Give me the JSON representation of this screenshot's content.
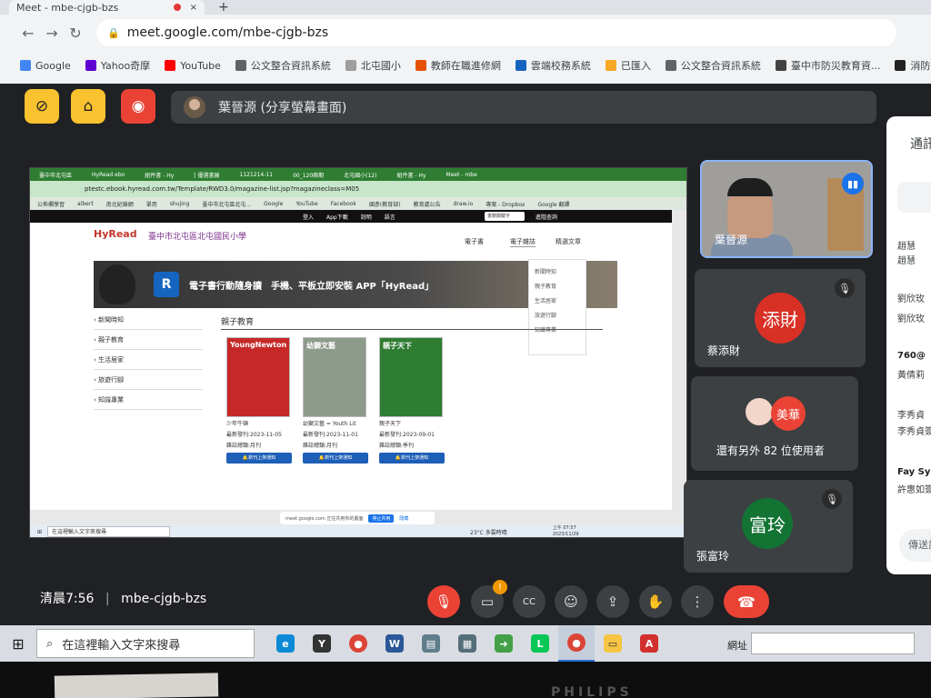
{
  "browser": {
    "tab_title": "Meet - mbe-cjgb-bzs",
    "close_glyph": "×",
    "newtab_glyph": "+",
    "url": "meet.google.com/mbe-cjgb-bzs",
    "bookmarks": [
      {
        "label": "Google",
        "color": "#4285f4"
      },
      {
        "label": "Yahoo奇摩",
        "color": "#5f01d1"
      },
      {
        "label": "YouTube",
        "color": "#ff0000"
      },
      {
        "label": "公文整合資訊系統",
        "color": "#5f6368"
      },
      {
        "label": "北屯國小",
        "color": "#9e9e9e"
      },
      {
        "label": "教師在職進修網",
        "color": "#e65100"
      },
      {
        "label": "雲端校務系統",
        "color": "#1565c0"
      },
      {
        "label": "已匯入",
        "color": "#f9a825"
      },
      {
        "label": "公文整合資訊系統",
        "color": "#5f6368"
      },
      {
        "label": "臺中市防災教育資...",
        "color": "#424242"
      },
      {
        "label": "消防車 -",
        "color": "#222222"
      }
    ]
  },
  "meet": {
    "presenter_label": "葉晉源 (分享螢幕畫面)",
    "clock": "清晨7:56",
    "meeting_code": "mbe-cjgb-bzs",
    "separator": "|",
    "participants": [
      {
        "name": "葉晉源"
      },
      {
        "name": "蔡添財",
        "avatar_text": "添財",
        "avatar_color": "#d93025"
      },
      {
        "name": "還有另外 82 位使用者",
        "avatar_text": "美華",
        "avatar_color": "#ea4335"
      },
      {
        "name": "張富玲",
        "avatar_text": "富玲",
        "avatar_color": "#137333"
      }
    ],
    "chat": {
      "title": "通訊",
      "messages": [
        {
          "text": "趙慧",
          "bold": false
        },
        {
          "text": "趙慧",
          "bold": false
        },
        {
          "text": "劉欣玫",
          "bold": false
        },
        {
          "text": "劉欣玫",
          "bold": false
        },
        {
          "text": "760@",
          "bold": true
        },
        {
          "text": "黃倩莉",
          "bold": false
        },
        {
          "text": "李秀貞",
          "bold": false
        },
        {
          "text": "李秀貞簽",
          "bold": false
        },
        {
          "text": "Fay Syu",
          "bold": true
        },
        {
          "text": "許惠如簽",
          "bold": false
        }
      ],
      "input_placeholder": "傳送訊息"
    },
    "notification_badge": "!"
  },
  "shared_screen": {
    "url": "ptestc.ebook.hyread.com.tw/Template/RWD3.0/magazine-list.jsp?magazineclass=M05",
    "tabs": [
      "臺中市北屯區",
      "HyRead ebo",
      "組件書 - Hy",
      "[ 優選書展",
      "1121214-11",
      "00_120兩期",
      "北屯國小(12)",
      "組件書 - Hy",
      "Meet - mbe"
    ],
    "bookmarks": [
      "公佈欄學習",
      "albert",
      "南北紀錄網",
      "單用",
      "shujing",
      "臺中市北屯區北屯...",
      "Google",
      "YouTube",
      "Facebook",
      "國彥(教育部)",
      "教育處公告",
      "draw.io",
      "專案 - Dropbox",
      "Google 翻譯"
    ],
    "topbar": [
      "登入",
      "App下載",
      "說明",
      "語言"
    ],
    "search_label": "書籍關鍵字",
    "advanced_search": "進階查詢",
    "logo": "HyRead",
    "school": "臺中市北屯區北屯國民小學",
    "nav": [
      "電子書",
      "電子雜誌",
      "精選文章"
    ],
    "banner": "電子書行動隨身讀　手機、平板立即安裝 APP「HyRead」",
    "banner_icon": "R",
    "dropdown": [
      "新聞時知",
      "親子教育",
      "生活居家",
      "旅遊行腳",
      "知識專業"
    ],
    "sidebar": [
      "新聞時知",
      "親子教育",
      "生活居家",
      "旅遊行腳",
      "知識專業"
    ],
    "heading": "親子教育",
    "books": [
      {
        "cover_title": "YoungNewton",
        "name": "少年牛頓",
        "date": "最新發刊:2023-11-05",
        "meta": "雜誌總類:月刊",
        "btn": "新刊上架通知",
        "color": "#c62828"
      },
      {
        "cover_title": "幼獅文藝",
        "name": "幼獅文藝 = Youth Lit",
        "date": "最新發刊:2023-11-01",
        "meta": "雜誌總類:月刊",
        "btn": "新刊上架通知",
        "color": "#8d9b8a"
      },
      {
        "cover_title": "親子天下",
        "name": "親子天下",
        "date": "最新發刊:2023-09-01",
        "meta": "雜誌總類:季刊",
        "btn": "新刊上架通知",
        "color": "#2e7d32"
      }
    ],
    "share_notice": "meet.google.com 正在共用你的畫面",
    "share_stop": "停止共用",
    "share_hide": "隱藏",
    "taskbar_search": "在這裡輸入文字來搜尋",
    "weather": "23°C 多雲時晴",
    "time": "上午 07:57",
    "date": "2023/11/29"
  },
  "taskbar": {
    "search_placeholder": "在這裡輸入文字來搜尋",
    "address_label": "網址"
  },
  "monitor": {
    "brand": "PHILIPS"
  }
}
